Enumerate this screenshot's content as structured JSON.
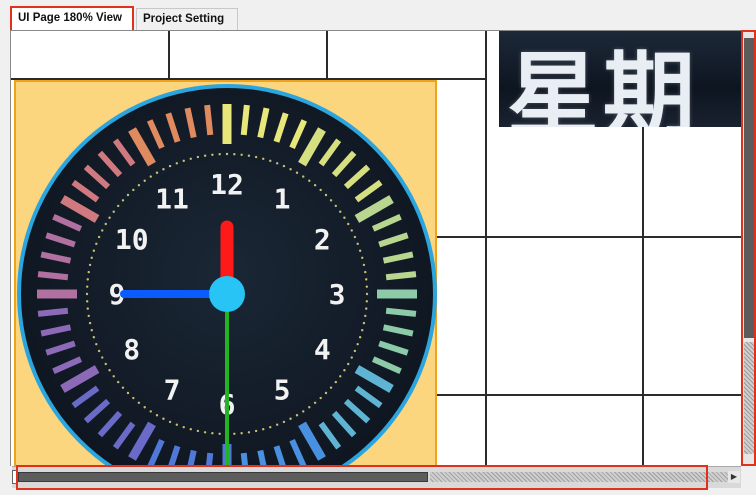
{
  "tabs": [
    {
      "label": "UI Page 180% View",
      "active": true
    },
    {
      "label": "Project Setting",
      "active": false
    }
  ],
  "canvas": {
    "weekday_text": "星期",
    "clock": {
      "numbers": [
        "12",
        "1",
        "2",
        "3",
        "4",
        "5",
        "6",
        "7",
        "8",
        "9",
        "10",
        "11"
      ],
      "hands": {
        "hour_color": "#ff1a1a",
        "minute_color": "#0a5cff",
        "second_color": "#22b422",
        "hub_color": "#27c4f5"
      },
      "face_color": "#101a26",
      "rim_color": "#2aa5df"
    },
    "background_color": "#fcd57f"
  },
  "scrollbars": {
    "vertical": {
      "icon": "scrollbar-vertical"
    },
    "horizontal": {
      "icon": "scrollbar-horizontal"
    }
  },
  "colors": {
    "highlight": "#e0301e",
    "grid": "#2b2b2b"
  }
}
